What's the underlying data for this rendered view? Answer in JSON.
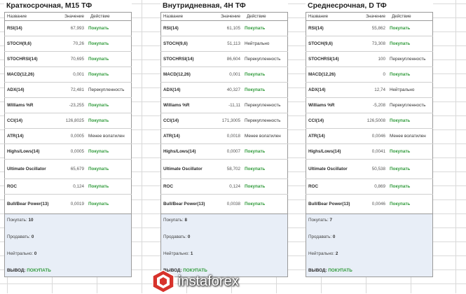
{
  "panels": [
    {
      "title": "Краткосрочная, M15 ТФ",
      "headers": {
        "name": "Название",
        "value": "Значение",
        "action": "Действие"
      },
      "rows": [
        {
          "name": "RSI(14)",
          "value": "67,993",
          "action": "Покупать",
          "buy": true
        },
        {
          "name": "STOCH(9,6)",
          "value": "70,26",
          "action": "Покупать",
          "buy": true
        },
        {
          "name": "STOCHRSI(14)",
          "value": "70,695",
          "action": "Покупать",
          "buy": true
        },
        {
          "name": "MACD(12,26)",
          "value": "0,001",
          "action": "Покупать",
          "buy": true
        },
        {
          "name": "ADX(14)",
          "value": "72,481",
          "action": "Перекупленность",
          "buy": false
        },
        {
          "name": "Williams %R",
          "value": "-23,255",
          "action": "Покупать",
          "buy": true
        },
        {
          "name": "CCI(14)",
          "value": "126,8025",
          "action": "Покупать",
          "buy": true
        },
        {
          "name": "ATR(14)",
          "value": "0,0005",
          "action": "Менее волатилен",
          "buy": false
        },
        {
          "name": "Highs/Lows(14)",
          "value": "0,0005",
          "action": "Покупать",
          "buy": true
        },
        {
          "name": "Ultimate Oscillator",
          "value": "65,679",
          "action": "Покупать",
          "buy": true
        },
        {
          "name": "ROC",
          "value": "0,124",
          "action": "Покупать",
          "buy": true
        },
        {
          "name": "Bull/Bear Power(13)",
          "value": "0,0019",
          "action": "Покупать",
          "buy": true
        }
      ],
      "summary": {
        "buy_label": "Покупать:",
        "buy": "10",
        "sell_label": "Продавать:",
        "sell": "0",
        "neutral_label": "Нейтрально:",
        "neutral": "0",
        "verdict_label": "ВЫВОД:",
        "verdict": "ПОКУПАТЬ"
      }
    },
    {
      "title": "Внутридневная, 4H ТФ",
      "headers": {
        "name": "Название",
        "value": "Значение",
        "action": "Действие"
      },
      "rows": [
        {
          "name": "RSI(14)",
          "value": "61,105",
          "action": "Покупать",
          "buy": true
        },
        {
          "name": "STOCH(9,6)",
          "value": "51,113",
          "action": "Нейтрально",
          "buy": false
        },
        {
          "name": "STOCHRSI(14)",
          "value": "86,604",
          "action": "Перекупленность",
          "buy": false
        },
        {
          "name": "MACD(12,26)",
          "value": "0,001",
          "action": "Покупать",
          "buy": true
        },
        {
          "name": "ADX(14)",
          "value": "40,327",
          "action": "Покупать",
          "buy": true
        },
        {
          "name": "Williams %R",
          "value": "-11,11",
          "action": "Перекупленность",
          "buy": false
        },
        {
          "name": "CCI(14)",
          "value": "171,3005",
          "action": "Перекупленность",
          "buy": false
        },
        {
          "name": "ATR(14)",
          "value": "0,0018",
          "action": "Менее волатилен",
          "buy": false
        },
        {
          "name": "Highs/Lows(14)",
          "value": "0,0007",
          "action": "Покупать",
          "buy": true
        },
        {
          "name": "Ultimate Oscillator",
          "value": "58,702",
          "action": "Покупать",
          "buy": true
        },
        {
          "name": "ROC",
          "value": "0,124",
          "action": "Покупать",
          "buy": true
        },
        {
          "name": "Bull/Bear Power(13)",
          "value": "0,0038",
          "action": "Покупать",
          "buy": true
        }
      ],
      "summary": {
        "buy_label": "Покупать:",
        "buy": "8",
        "sell_label": "Продавать:",
        "sell": "0",
        "neutral_label": "Нейтрально:",
        "neutral": "1",
        "verdict_label": "ВЫВОД:",
        "verdict": "ПОКУПАТЬ"
      }
    },
    {
      "title": "Среднесрочная, D ТФ",
      "headers": {
        "name": "Название",
        "value": "Значение",
        "action": "Действие"
      },
      "rows": [
        {
          "name": "RSI(14)",
          "value": "55,862",
          "action": "Покупать",
          "buy": true
        },
        {
          "name": "STOCH(9,6)",
          "value": "73,308",
          "action": "Покупать",
          "buy": true
        },
        {
          "name": "STOCHRSI(14)",
          "value": "100",
          "action": "Перекупленность",
          "buy": false
        },
        {
          "name": "MACD(12,26)",
          "value": "0",
          "action": "Покупать",
          "buy": true
        },
        {
          "name": "ADX(14)",
          "value": "12,74",
          "action": "Нейтрально",
          "buy": false
        },
        {
          "name": "Williams %R",
          "value": "-5,208",
          "action": "Перекупленность",
          "buy": false
        },
        {
          "name": "CCI(14)",
          "value": "126,5008",
          "action": "Покупать",
          "buy": true
        },
        {
          "name": "ATR(14)",
          "value": "0,0046",
          "action": "Менее волатилен",
          "buy": false
        },
        {
          "name": "Highs/Lows(14)",
          "value": "0,0041",
          "action": "Покупать",
          "buy": true
        },
        {
          "name": "Ultimate Oscillator",
          "value": "50,538",
          "action": "Покупать",
          "buy": true
        },
        {
          "name": "ROC",
          "value": "0,869",
          "action": "Покупать",
          "buy": true
        },
        {
          "name": "Bull/Bear Power(13)",
          "value": "0,0046",
          "action": "Покупать",
          "buy": true
        }
      ],
      "summary": {
        "buy_label": "Покупать:",
        "buy": "7",
        "sell_label": "Продавать:",
        "sell": "0",
        "neutral_label": "Нейтрально:",
        "neutral": "2",
        "verdict_label": "ВЫВОД:",
        "verdict": "ПОКУПАТЬ"
      }
    }
  ],
  "watermark": {
    "text": "instaforex",
    "icon": "instaforex-logo-icon"
  },
  "colors": {
    "buy": "#2f9a3a",
    "summary_bg": "#e8eef7",
    "border": "#9a9a9a"
  }
}
